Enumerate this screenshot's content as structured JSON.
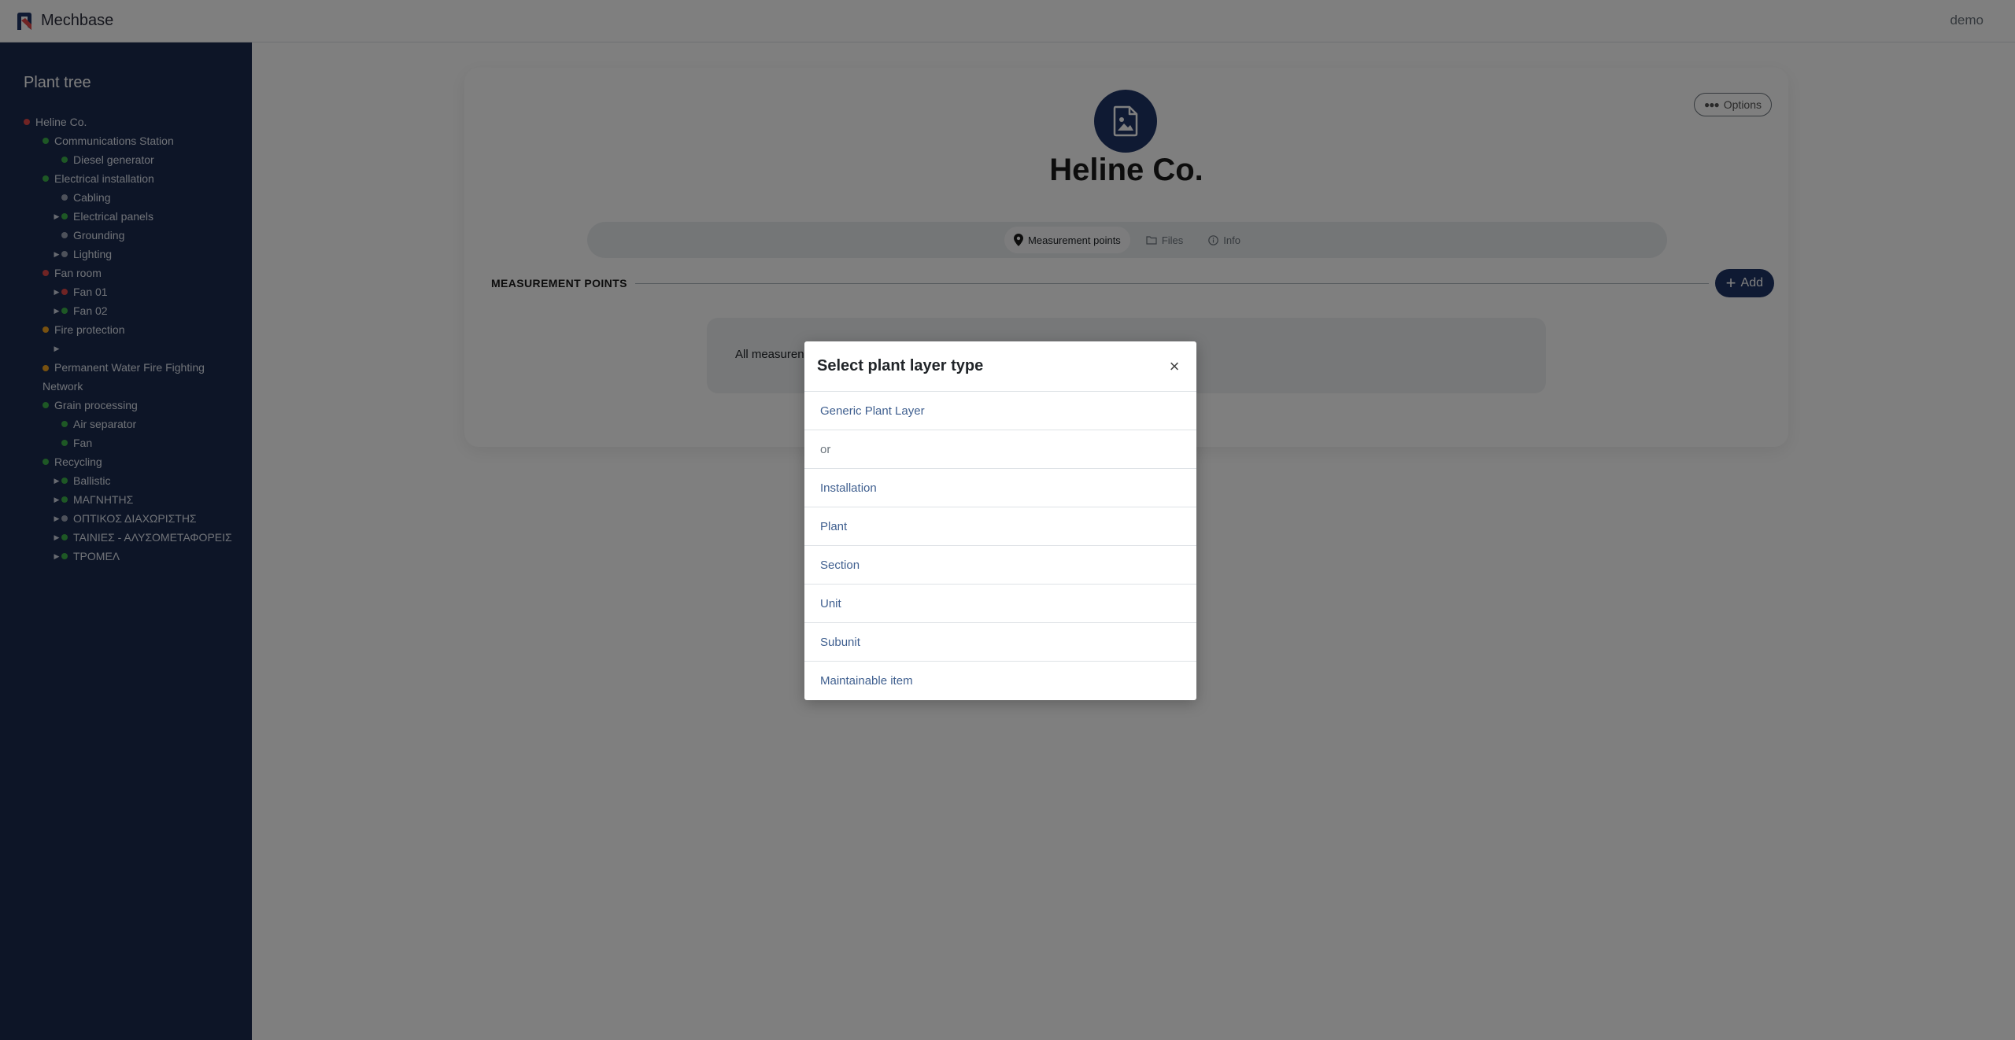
{
  "app": {
    "name": "Mechbase",
    "user": "demo"
  },
  "sidebar": {
    "title": "Plant tree",
    "items": [
      {
        "label": "Heline Co.",
        "status": "red",
        "level": 0,
        "expandable": false
      },
      {
        "label": "Communications Station",
        "status": "green",
        "level": 1,
        "expandable": false
      },
      {
        "label": "Diesel generator",
        "status": "green",
        "level": 2,
        "expandable": false
      },
      {
        "label": "Electrical installation",
        "status": "green",
        "level": 1,
        "expandable": false
      },
      {
        "label": "Cabling",
        "status": "gray",
        "level": 2,
        "expandable": false
      },
      {
        "label": "Electrical panels",
        "status": "green",
        "level": 2,
        "expandable": true
      },
      {
        "label": "Grounding",
        "status": "gray",
        "level": 2,
        "expandable": false
      },
      {
        "label": "Lighting",
        "status": "gray",
        "level": 2,
        "expandable": true
      },
      {
        "label": "Fan room",
        "status": "red",
        "level": 1,
        "expandable": false
      },
      {
        "label": "Fan 01",
        "status": "red",
        "level": 2,
        "expandable": true
      },
      {
        "label": "Fan 02",
        "status": "green",
        "level": 2,
        "expandable": true
      },
      {
        "label": "Fire protection",
        "status": "orange",
        "level": 1,
        "expandable": false
      },
      {
        "label": "",
        "status": "",
        "level": 2,
        "expandable": true
      },
      {
        "label": "Permanent Water Fire Fighting Network",
        "status": "orange",
        "level": 1,
        "expandable": false
      },
      {
        "label": "Grain processing",
        "status": "green",
        "level": 1,
        "expandable": false
      },
      {
        "label": "Air separator",
        "status": "green",
        "level": 2,
        "expandable": false
      },
      {
        "label": "Fan",
        "status": "green",
        "level": 2,
        "expandable": false
      },
      {
        "label": "Recycling",
        "status": "green",
        "level": 1,
        "expandable": false
      },
      {
        "label": "Ballistic",
        "status": "green",
        "level": 2,
        "expandable": true
      },
      {
        "label": "ΜΑΓΝΗΤΗΣ",
        "status": "green",
        "level": 2,
        "expandable": true
      },
      {
        "label": "ΟΠΤΙΚΟΣ ΔΙΑΧΩΡΙΣΤΗΣ",
        "status": "gray",
        "level": 2,
        "expandable": true
      },
      {
        "label": "ΤΑΙΝΙΕΣ - ΑΛΥΣΟΜΕΤΑΦΟΡΕΙΣ",
        "status": "green",
        "level": 2,
        "expandable": true
      },
      {
        "label": "ΤΡΟΜΕΛ",
        "status": "green",
        "level": 2,
        "expandable": true
      }
    ]
  },
  "main": {
    "title": "Heline Co.",
    "options_label": "Options",
    "tabs": [
      {
        "label": "Measurement points",
        "icon": "map-pin-icon",
        "active": true
      },
      {
        "label": "Files",
        "icon": "folder-icon",
        "active": false
      },
      {
        "label": "Info",
        "icon": "info-icon",
        "active": false
      }
    ],
    "section_title": "MEASUREMENT POINTS",
    "add_label": "Add",
    "empty_text": "All measuren"
  },
  "modal": {
    "title": "Select plant layer type",
    "close_symbol": "×",
    "items": [
      {
        "label": "Generic Plant Layer",
        "separator": false
      },
      {
        "label": "or",
        "separator": true
      },
      {
        "label": "Installation",
        "separator": false
      },
      {
        "label": "Plant",
        "separator": false
      },
      {
        "label": "Section",
        "separator": false
      },
      {
        "label": "Unit",
        "separator": false
      },
      {
        "label": "Subunit",
        "separator": false
      },
      {
        "label": "Maintainable item",
        "separator": false
      }
    ]
  },
  "colors": {
    "sidebar_bg": "#1b2a4e",
    "accent": "#1f3466",
    "status_red": "#e04848",
    "status_green": "#3cb04a",
    "status_orange": "#f0a320"
  }
}
